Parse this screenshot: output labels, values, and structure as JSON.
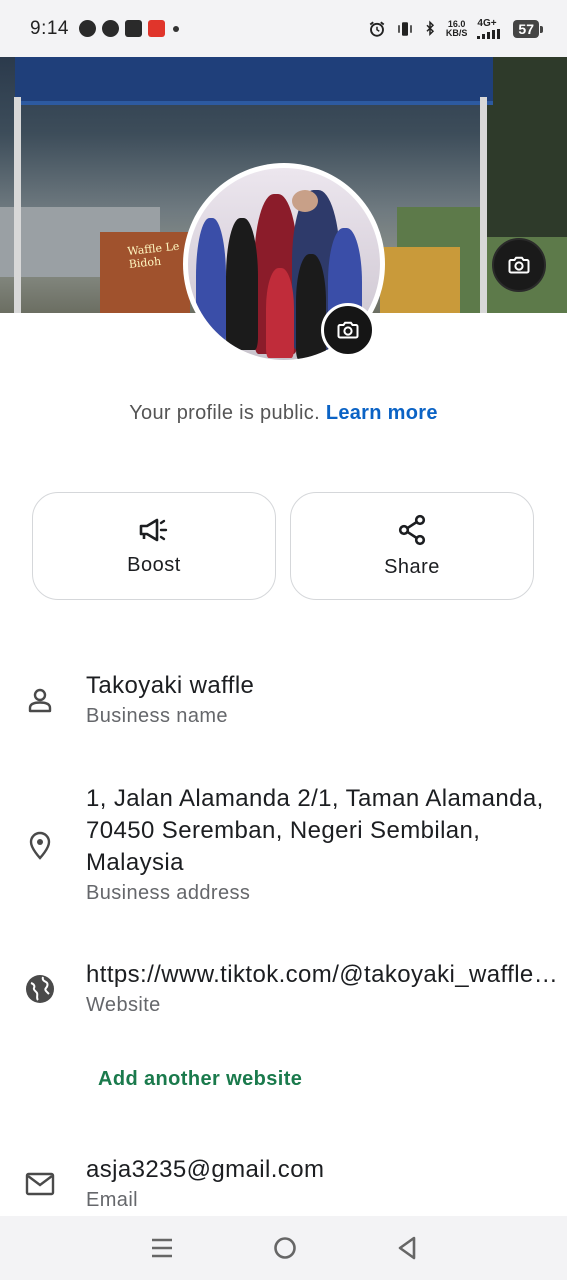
{
  "status_bar": {
    "time": "9:14",
    "net_speed_value": "16.0",
    "net_speed_unit": "KB/S",
    "network_type": "4G+",
    "battery": "57"
  },
  "profile": {
    "public_text": "Your profile is public.",
    "learn_more": "Learn more"
  },
  "actions": {
    "boost_label": "Boost",
    "share_label": "Share"
  },
  "info": {
    "business_name": {
      "value": "Takoyaki waffle",
      "caption": "Business name"
    },
    "address": {
      "value": "1, Jalan Alamanda 2/1, Taman Alamanda, 70450 Seremban, Negeri Sembilan, Malaysia",
      "caption": "Business address"
    },
    "website": {
      "value": "https://www.tiktok.com/@takoyaki_waffle_le_bidoh",
      "caption": "Website"
    },
    "add_website_label": "Add another website",
    "email": {
      "value": "asja3235@gmail.com",
      "caption": "Email"
    }
  },
  "cover_sign_text": "Waffle Le Bidoh",
  "colors": {
    "link_blue": "#0b63c5",
    "add_green": "#1a7a4c",
    "caption_gray": "#65676b"
  }
}
